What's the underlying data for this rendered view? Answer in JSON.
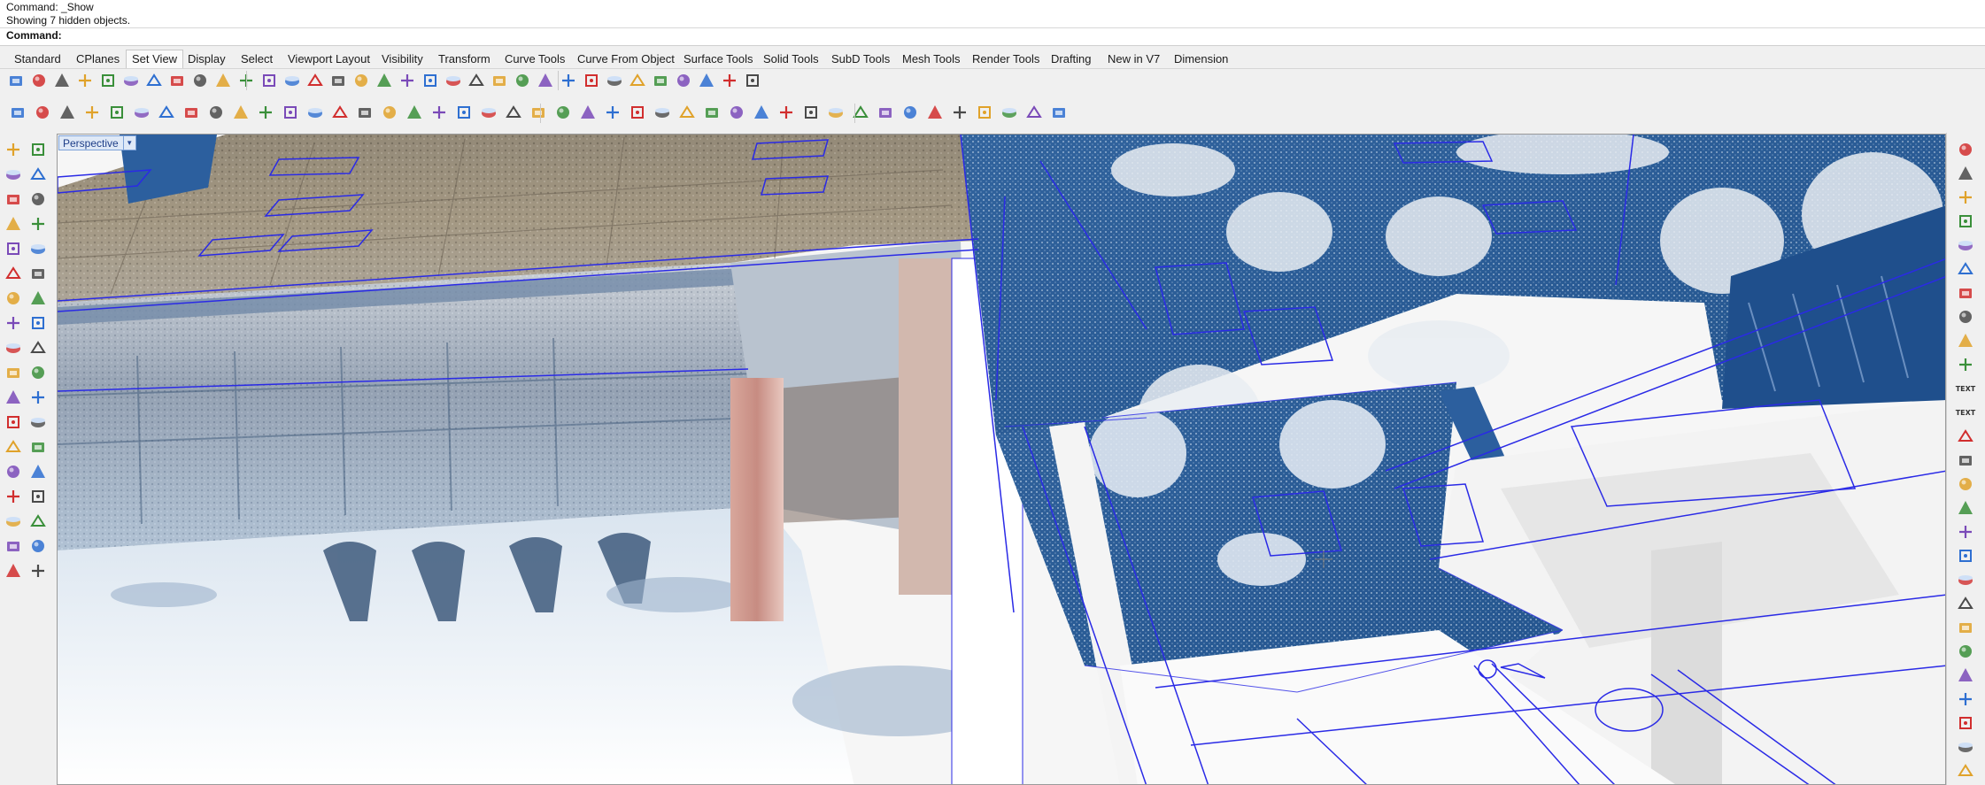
{
  "command": {
    "history_line1": "Command: _Show",
    "history_line2": "Showing 7 hidden objects.",
    "prompt": "Command:"
  },
  "tabs": [
    {
      "label": "Standard"
    },
    {
      "label": "CPlanes"
    },
    {
      "label": "Set View",
      "active": true
    },
    {
      "label": "Display"
    },
    {
      "label": "Select"
    },
    {
      "label": "Viewport Layout"
    },
    {
      "label": "Visibility"
    },
    {
      "label": "Transform"
    },
    {
      "label": "Curve Tools"
    },
    {
      "label": "Curve From Object"
    },
    {
      "label": "Surface Tools"
    },
    {
      "label": "Solid Tools"
    },
    {
      "label": "SubD Tools"
    },
    {
      "label": "Mesh Tools"
    },
    {
      "label": "Render Tools"
    },
    {
      "label": "Drafting"
    },
    {
      "label": "New in V7"
    },
    {
      "label": "Dimension"
    }
  ],
  "toolbar_row1_icons": [
    "pan-icon",
    "rotate-view-icon",
    "zoom-extents-icon",
    "zoom-window-icon",
    "zoom-dynamic-icon",
    "undo-view-icon",
    "zoom-all-icon",
    "named-view-icon",
    "properties-icon",
    "render-icon",
    "vehicle-icon",
    "vehicle-icon",
    "vehicle-icon",
    "vehicle-icon",
    "material-icon",
    "camera-icon",
    "printer-icon",
    "layout-icon",
    "capture-icon",
    "light-icon",
    "target-icon",
    "set-camera-icon",
    "grid-icon",
    "box-view-icon",
    "walkthrough-icon",
    "sun-icon",
    "orbit-icon",
    "walk-icon",
    "compass-icon",
    "plane-icon",
    "scale-icon",
    "star-icon",
    "snapshot-icon"
  ],
  "toolbar_row2_icons": [
    "box-icon",
    "cylinder-icon",
    "sphere-icon",
    "ellipsoid-icon",
    "paraboloid-icon",
    "pyramid-icon",
    "cone-icon",
    "truncated-cone-icon",
    "tetra-icon",
    "tube-icon",
    "torus-icon",
    "pipe-icon",
    "slab-icon",
    "shell-icon",
    "solid-group-icon",
    "extrude-icon",
    "extrude-taper-icon",
    "extrude-face-icon",
    "extrude-curve-icon",
    "cap-icon",
    "cone-solid-icon",
    "loft-icon",
    "rib-icon",
    "sweep-icon",
    "bowl-icon",
    "barrel-icon",
    "cage-icon",
    "pipe-solid-icon",
    "plane-solid-icon",
    "cube-solid-icon",
    "twist-icon",
    "fillet-icon",
    "shear-icon",
    "boolean-icon",
    "surface-icon",
    "patch-icon",
    "surface-grid-icon",
    "offset-icon",
    "contour-icon",
    "section-icon",
    "mesh-icon",
    "point-cloud-icon",
    "cube-explode-icon"
  ],
  "left_icons": [
    "select-icon",
    "point-icon",
    "polyline-icon",
    "control-point-icon",
    "circle-icon",
    "ellipse-icon",
    "arc-icon",
    "rectangle-icon",
    "polygon-icon",
    "curve-icon",
    "sphere-solid-icon",
    "box-solid-icon",
    "surface-plane-icon",
    "cylinder-solid-icon",
    "gear-icon",
    "pencil-icon",
    "lasso-icon",
    "array-icon",
    "mirror-icon",
    "join-icon",
    "fillet-curve-icon",
    "trim-icon",
    "group-icon",
    "explode-icon",
    "dimension-icon",
    "text-icon",
    "move-icon",
    "rotate-icon",
    "mesh-grid-icon",
    "lock-icon",
    "boolean-union-icon",
    "layer-icon",
    "hide-icon",
    "show-icon",
    "measure-icon",
    "paint-icon"
  ],
  "right_icons": [
    "snap-icon",
    "snap-end-icon",
    "snap-mid-icon",
    "snap-center-icon",
    "snap-quad-icon",
    "snap-knot-icon",
    "snap-vertex-icon",
    "snap-perp-icon",
    "snap-tan-icon",
    "shield-icon",
    "text-label-icon",
    "text-label-icon",
    "angle-icon",
    "leader-icon",
    "dimension-icon",
    "hatch-icon",
    "block-icon",
    "bookmark-icon",
    "checkmark-icon",
    "material-icon",
    "layer-stack-icon",
    "frame-icon",
    "grid-icon",
    "folder-icon",
    "sphere-render-icon",
    "gear-icon",
    "file-icon"
  ],
  "right_text_icons": [
    "TEXT",
    "TEXT"
  ],
  "viewport": {
    "title": "Perspective"
  },
  "colors": {
    "accent": "#1f66c8",
    "wire": "#2a2ae6",
    "solid_blue": "#1f5b99"
  }
}
